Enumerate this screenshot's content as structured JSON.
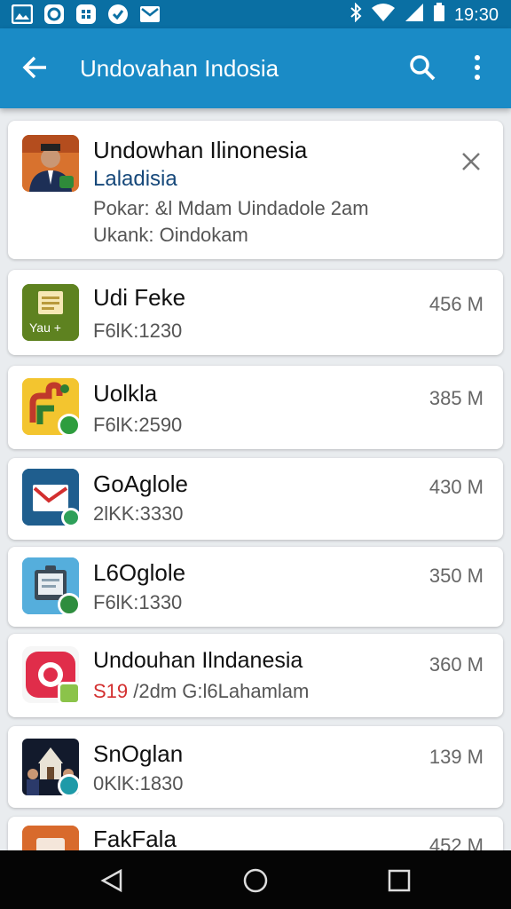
{
  "status": {
    "time": "19:30"
  },
  "appbar": {
    "title": "Undovahan Indosia"
  },
  "featured": {
    "name": "Undowhan Ilinonesia",
    "developer": "Laladisia",
    "line1": "Pokar: &l Mdam Uindadole 2am",
    "line2": "Ukank: Oindokam"
  },
  "apps": [
    {
      "name": "Udi Feke",
      "sub": "F6lK:1230",
      "size": "456 M",
      "icon_text": "Yau +"
    },
    {
      "name": "Uolkla",
      "sub": "F6lK:2590",
      "size": "385 M"
    },
    {
      "name": "GoAglole",
      "sub": "2lKK:3330",
      "size": "430 M"
    },
    {
      "name": "L6Oglole",
      "sub": "F6lK:1330",
      "size": "350 M"
    },
    {
      "name": "Undouhan Ilndanesia",
      "sub_highlight": "S19",
      "sub": " /2dm G:l6Lahamlam",
      "size": "360 M"
    },
    {
      "name": "SnOglan",
      "sub": "0KlK:1830",
      "size": "139 M"
    },
    {
      "name": "FakFala",
      "sub": "",
      "size": "452 M"
    }
  ],
  "colors": {
    "appbar": "#1a8bc6",
    "statusbar": "#0a6fa3",
    "highlight_red": "#d32f2f"
  }
}
